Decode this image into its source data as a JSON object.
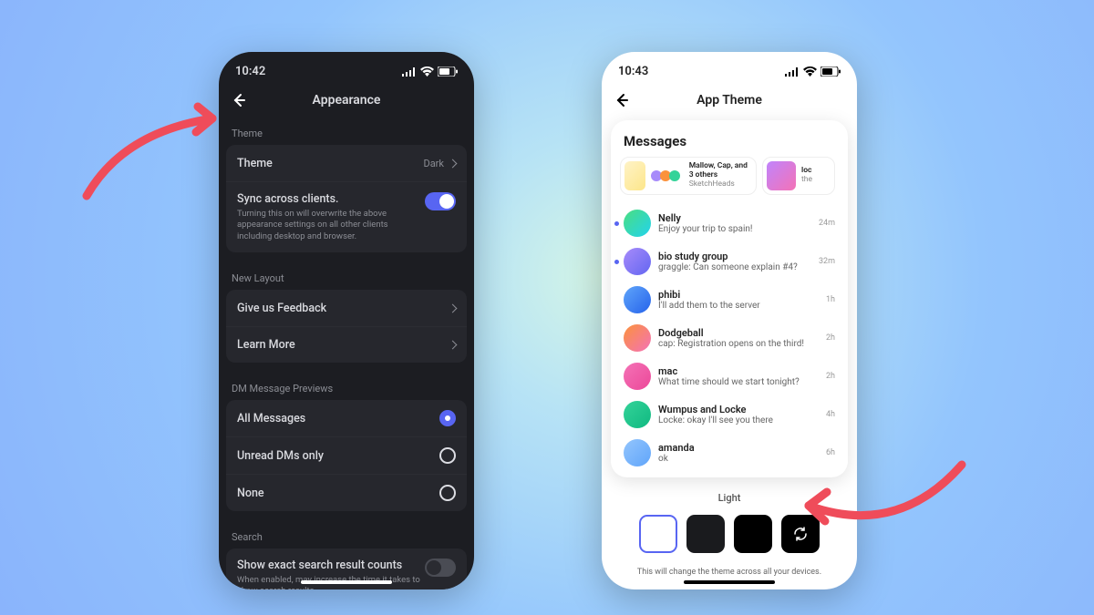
{
  "left": {
    "time": "10:42",
    "title": "Appearance",
    "theme_section": "Theme",
    "theme_row": {
      "label": "Theme",
      "value": "Dark"
    },
    "sync": {
      "title": "Sync across clients.",
      "sub": "Turning this on will overwrite the above appearance settings on all other clients including desktop and browser."
    },
    "layout_section": "New Layout",
    "feedback": "Give us Feedback",
    "learn_more": "Learn More",
    "dm_section": "DM Message Previews",
    "radio": {
      "all": "All Messages",
      "unread": "Unread DMs only",
      "none": "None"
    },
    "search_section": "Search",
    "search_row": {
      "title": "Show exact search result counts",
      "sub": "When enabled, may increase the time it takes to show search results."
    }
  },
  "right": {
    "time": "10:43",
    "title": "App Theme",
    "messages_heading": "Messages",
    "card1": {
      "title": "Mallow, Cap, and 3 others",
      "sub": "SketchHeads"
    },
    "card2": {
      "title": "loc",
      "sub": "the"
    },
    "conversations": [
      {
        "name": "Nelly",
        "preview": "Enjoy your trip to spain!",
        "time": "24m",
        "unread": true,
        "avatar": "linear-gradient(135deg,#4ade80,#22d3ee)"
      },
      {
        "name": "bio study group",
        "preview": "graggle: Can someone explain #4?",
        "time": "32m",
        "unread": true,
        "avatar": "linear-gradient(135deg,#a78bfa,#6366f1)"
      },
      {
        "name": "phibi",
        "preview": "I'll add them to the server",
        "time": "1h",
        "unread": false,
        "avatar": "linear-gradient(135deg,#60a5fa,#2563eb)"
      },
      {
        "name": "Dodgeball",
        "preview": "cap: Registration opens on the third!",
        "time": "2h",
        "unread": false,
        "avatar": "linear-gradient(135deg,#fb923c,#f472b6)"
      },
      {
        "name": "mac",
        "preview": "What time should we start tonight?",
        "time": "2h",
        "unread": false,
        "avatar": "linear-gradient(135deg,#f472b6,#ec4899)"
      },
      {
        "name": "Wumpus and Locke",
        "preview": "Locke: okay I'll see you there",
        "time": "4h",
        "unread": false,
        "avatar": "linear-gradient(135deg,#34d399,#10b981)"
      },
      {
        "name": "amanda",
        "preview": "ok",
        "time": "6h",
        "unread": false,
        "avatar": "linear-gradient(135deg,#93c5fd,#60a5fa)"
      }
    ],
    "selected_theme": "Light",
    "footer": "This will change the theme across all your devices."
  }
}
